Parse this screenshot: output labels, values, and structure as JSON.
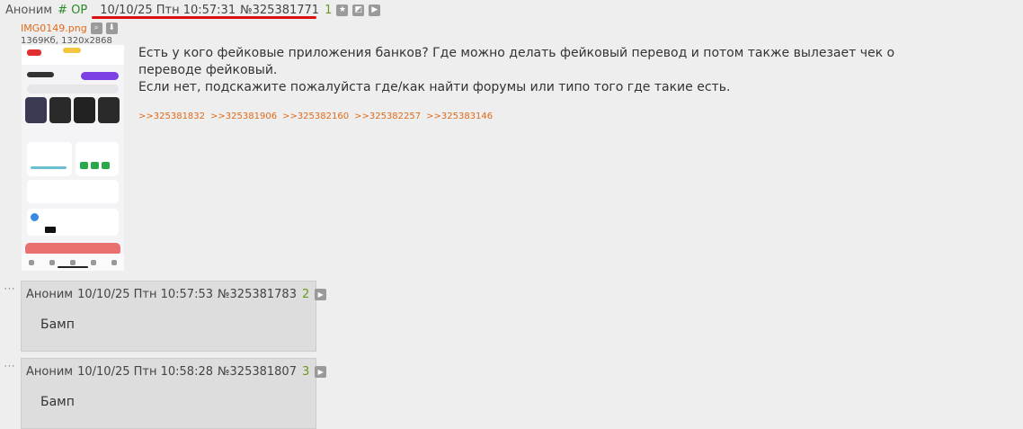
{
  "op": {
    "author": "Аноним",
    "trip": "# OP",
    "date": "10/10/25 Птн 10:57:31",
    "number": "№325381771",
    "ordinal": "1",
    "file": {
      "name": "IMG0149.png",
      "meta": "1369Кб, 1320x2868"
    },
    "body": [
      "Есть у кого фейковые приложения банков? Где можно делать фейковый перевод и потом также вылезает чек о переводе фейковый.",
      "Если нет, подскажите пожалуйста где/как найти форумы или типо того где такие есть."
    ],
    "reply_links": [
      ">>325381832",
      ">>325381906",
      ">>325382160",
      ">>325382257",
      ">>325383146"
    ]
  },
  "replies": [
    {
      "author": "Аноним",
      "date": "10/10/25 Птн 10:57:53",
      "number": "№325381783",
      "ordinal": "2",
      "text": "Бамп"
    },
    {
      "author": "Аноним",
      "date": "10/10/25 Птн 10:58:28",
      "number": "№325381807",
      "ordinal": "3",
      "text": "Бамп"
    }
  ],
  "icons": [
    "star-icon",
    "hide-icon",
    "play-icon",
    "search-icon",
    "download-icon"
  ],
  "colors": {
    "background": "#eeeeee",
    "reply_bg": "#dddddd",
    "trip": "#2a8a2a",
    "ordinal": "#6a9a1a",
    "link": "#e06a1a",
    "underline": "#dd1111"
  }
}
